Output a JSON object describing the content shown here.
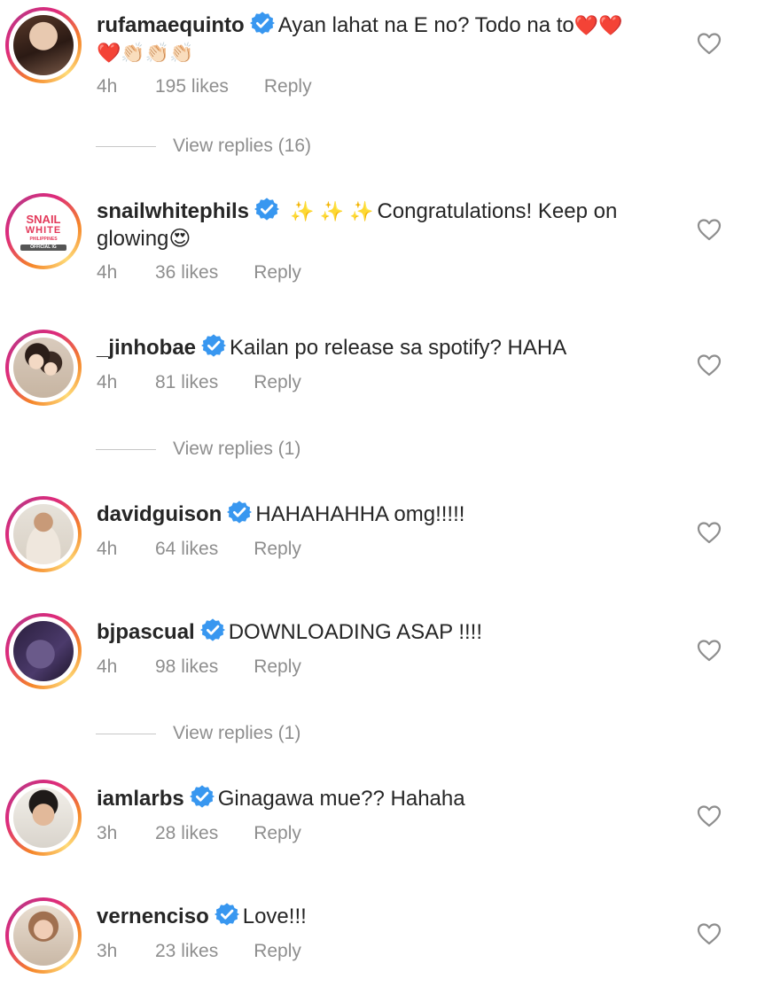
{
  "comments": [
    {
      "username": "rufamaequinto",
      "text": "Ayan lahat na E no? Todo na to",
      "emoji_tail": "❤️❤️",
      "line2": "❤️👏🏻👏🏻👏🏻",
      "time": "4h",
      "likes": "195 likes",
      "reply": "Reply"
    },
    {
      "username": "snailwhitephils",
      "emoji_lead": "✨ ✨ ✨",
      "text": "Congratulations! Keep on",
      "line2": "glowing😍",
      "time": "4h",
      "likes": "36 likes",
      "reply": "Reply",
      "avatar_logo": {
        "line1": "SNAIL",
        "line2": "WHITE",
        "line3": "PHILIPPINES",
        "line4": "OFFICIAL IG"
      }
    },
    {
      "username": "_jinhobae",
      "text": "Kailan po release sa spotify? HAHA",
      "time": "4h",
      "likes": "81 likes",
      "reply": "Reply"
    },
    {
      "username": "davidguison",
      "text": "HAHAHAHHA omg!!!!!",
      "time": "4h",
      "likes": "64 likes",
      "reply": "Reply"
    },
    {
      "username": "bjpascual",
      "text": "DOWNLOADING ASAP !!!!",
      "time": "4h",
      "likes": "98 likes",
      "reply": "Reply"
    },
    {
      "username": "iamlarbs",
      "text": "Ginagawa mue?? Hahaha",
      "time": "3h",
      "likes": "28 likes",
      "reply": "Reply"
    },
    {
      "username": "vernenciso",
      "text": "Love!!!",
      "time": "3h",
      "likes": "23 likes",
      "reply": "Reply"
    }
  ],
  "view_replies": [
    "View replies (16)",
    "View replies (1)",
    "View replies (1)"
  ],
  "colors": {
    "verified": "#3897f0",
    "secondary_text": "#8e8e8e",
    "primary_text": "#262626",
    "avatar_ring": "#dd2a7b"
  },
  "icons": [
    "verified-badge-icon",
    "heart-icon"
  ]
}
